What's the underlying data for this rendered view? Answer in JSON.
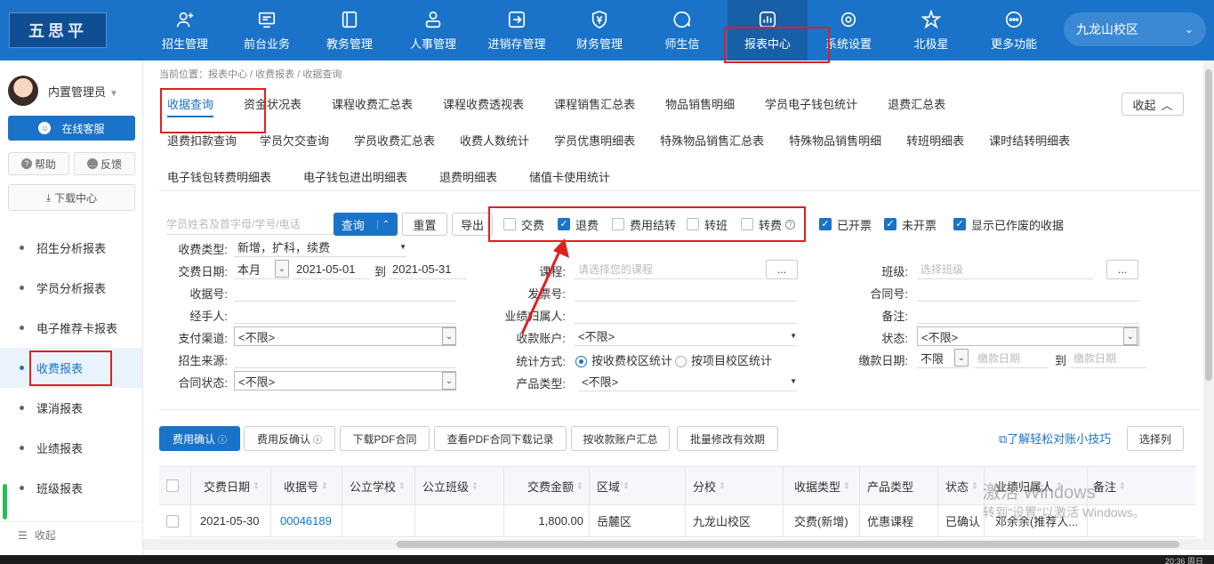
{
  "header": {
    "logo_text": "五思平",
    "nav": [
      {
        "label": "招生管理",
        "icon": "user-plus-icon"
      },
      {
        "label": "前台业务",
        "icon": "monitor-icon"
      },
      {
        "label": "教务管理",
        "icon": "book-icon"
      },
      {
        "label": "人事管理",
        "icon": "person-icon"
      },
      {
        "label": "进销存管理",
        "icon": "login-icon"
      },
      {
        "label": "财务管理",
        "icon": "yen-shield-icon"
      },
      {
        "label": "师生信",
        "icon": "chat-icon"
      },
      {
        "label": "报表中心",
        "icon": "chart-icon"
      },
      {
        "label": "系统设置",
        "icon": "gear-icon"
      },
      {
        "label": "北极星",
        "icon": "star-icon"
      },
      {
        "label": "更多功能",
        "icon": "more-icon"
      }
    ],
    "campus": "九龙山校区",
    "active_nav": "报表中心"
  },
  "sidebar": {
    "username": "内置管理员",
    "online_service": "在线客服",
    "help": "帮助",
    "feedback": "反馈",
    "download_center": "下载中心",
    "items": [
      "招生分析报表",
      "学员分析报表",
      "电子推荐卡报表",
      "收费报表",
      "课消报表",
      "业绩报表",
      "班级报表"
    ],
    "active_item": "收费报表",
    "collapse": "收起"
  },
  "breadcrumb": "当前位置：报表中心 / 收费报表 / 收据查询",
  "tabs": {
    "row1": [
      "收据查询",
      "资金状况表",
      "课程收费汇总表",
      "课程收费透视表",
      "课程销售汇总表",
      "物品销售明细",
      "学员电子钱包统计",
      "退费汇总表"
    ],
    "row2": [
      "退费扣款查询",
      "学员欠交查询",
      "学员收费汇总表",
      "收费人数统计",
      "学员优惠明细表",
      "特殊物品销售汇总表",
      "特殊物品销售明细",
      "转班明细表",
      "课时结转明细表"
    ],
    "row3": [
      "电子钱包转费明细表",
      "电子钱包进出明细表",
      "退费明细表",
      "储值卡使用统计"
    ],
    "active": "收据查询",
    "collapse": "收起"
  },
  "search": {
    "placeholder": "学员姓名及首字母/学号/电话",
    "query": "查询",
    "reset": "重置",
    "export": "导出",
    "checks": [
      {
        "label": "交费",
        "checked": false
      },
      {
        "label": "退费",
        "checked": true
      },
      {
        "label": "费用结转",
        "checked": false
      },
      {
        "label": "转班",
        "checked": false
      },
      {
        "label": "转费",
        "checked": false
      }
    ],
    "checks_right": [
      {
        "label": "已开票",
        "checked": true
      },
      {
        "label": "未开票",
        "checked": true
      },
      {
        "label": "显示已作废的收据",
        "checked": true
      }
    ]
  },
  "form": {
    "receipt_type_label": "收费类型:",
    "receipt_type_value": "新增，扩科，续费",
    "pay_date_label": "交费日期:",
    "pay_date_period": "本月",
    "date_from": "2021-05-01",
    "date_to_sep": "到",
    "date_to": "2021-05-31",
    "receipt_no_label": "收据号:",
    "handler_label": "经手人:",
    "pay_channel_label": "支付渠道:",
    "pay_channel_value": "<不限>",
    "source_label": "招生来源:",
    "contract_status_label": "合同状态:",
    "contract_status_value": "<不限>",
    "course_label": "课程:",
    "course_placeholder": "请选择您的课程",
    "invoice_label": "发票号:",
    "perf_label": "业绩归属人:",
    "account_label": "收款账户:",
    "account_value": "<不限>",
    "stat_label": "统计方式:",
    "stat_opt1": "按收费校区统计",
    "stat_opt2": "按项目校区统计",
    "product_label": "产品类型:",
    "product_value": "<不限>",
    "class_label": "班级:",
    "class_placeholder": "选择班级",
    "contract_label": "合同号:",
    "remark_label": "备注:",
    "status_label": "状态:",
    "status_value": "<不限>",
    "pay_due_label": "缴款日期:",
    "pay_due_period": "不限",
    "pay_due_from": "缴款日期",
    "pay_due_sep": "到",
    "pay_due_to": "缴款日期",
    "dots": "..."
  },
  "actions": [
    "费用确认",
    "费用反确认",
    "下载PDF合同",
    "查看PDF合同下载记录",
    "按收款账户汇总",
    "批量修改有效期"
  ],
  "tip_link": "了解轻松对账小技巧",
  "choose_columns": "选择列",
  "table": {
    "headers": [
      "交费日期",
      "收据号",
      "公立学校",
      "公立班级",
      "交费金额",
      "区域",
      "分校",
      "收据类型",
      "产品类型",
      "状态",
      "业绩归属人",
      "备注"
    ],
    "rows": [
      [
        "2021-05-30",
        "00046189",
        "",
        "",
        "1,800.00",
        "岳麓区",
        "九龙山校区",
        "交费(新增)",
        "优惠课程",
        "已确认",
        "邓余余(推荐人...",
        ""
      ]
    ]
  },
  "watermark": {
    "line1": "激活 Windows",
    "line2": "转到\"设置\"以激活 Windows。"
  },
  "taskbar_time": "20:36 周日"
}
